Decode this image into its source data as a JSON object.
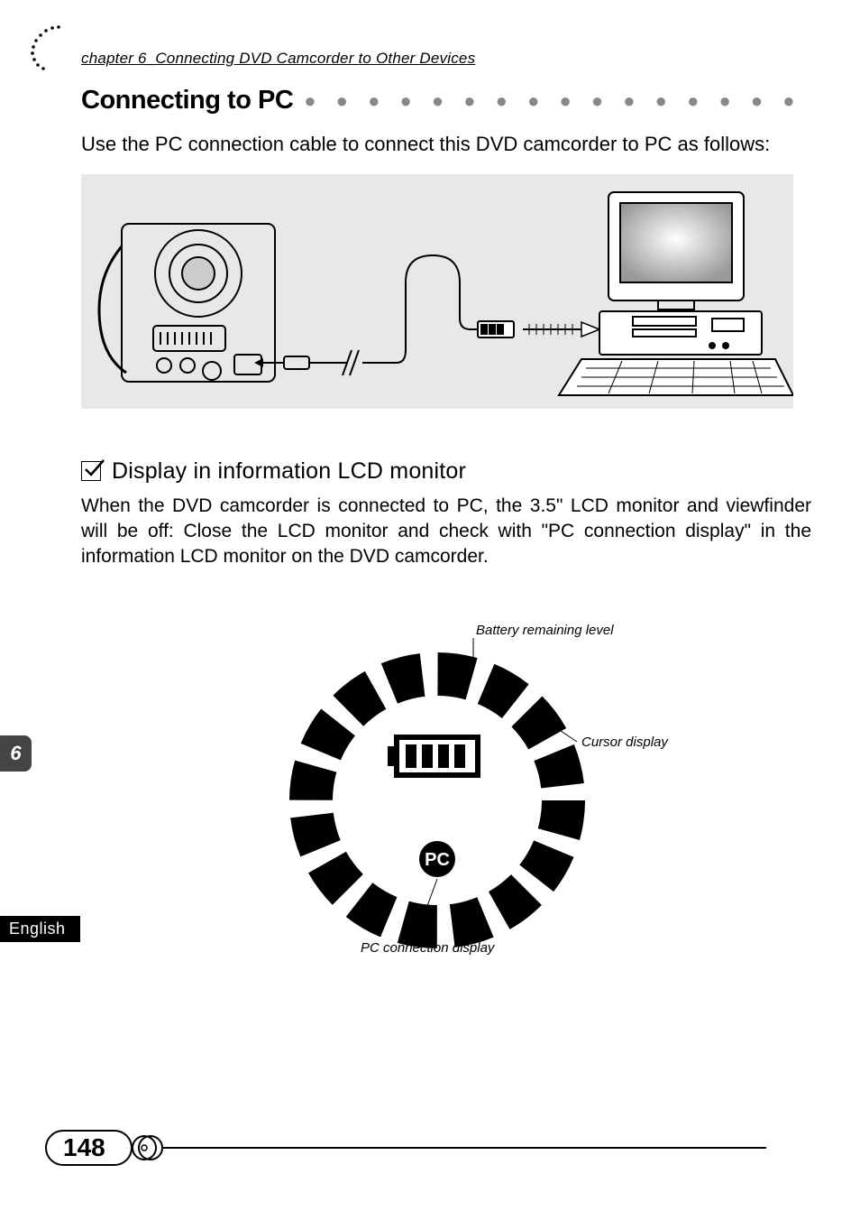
{
  "chapter_header": "chapter 6_Connecting DVD Camcorder to Other Devices",
  "main_title": "Connecting to PC",
  "dot_leader": "● ● ● ● ● ● ● ● ● ● ● ● ● ● ● ● ● ● ● ● ● ● ● ● ● ● ● ● ● ● ● ●",
  "intro_text": "Use the PC connection cable to connect this DVD camcorder to PC as follows:",
  "subhead": "Display in information LCD monitor",
  "body_text": "When the DVD camcorder is connected to PC, the 3.5\" LCD monitor and viewfinder will be off: Close the LCD monitor and check with \"PC connection display\" in the information LCD monitor on the DVD camcorder.",
  "lcd": {
    "battery_label": "Battery remaining level",
    "cursor_label": "Cursor display",
    "pc_label": "PC connection display",
    "pc_badge": "PC"
  },
  "side_tab": "6",
  "language_tab": "English",
  "page_number": "148"
}
